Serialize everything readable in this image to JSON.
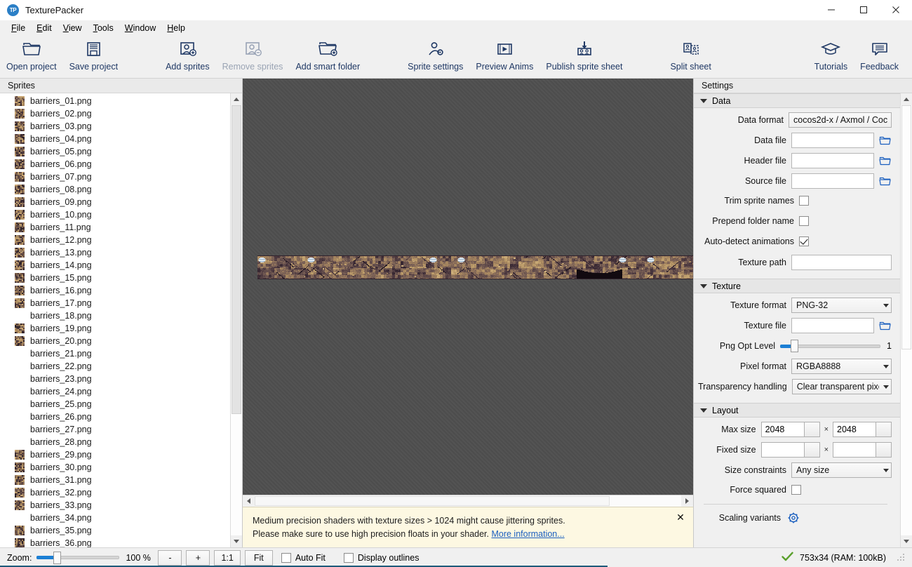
{
  "window": {
    "title": "TexturePacker",
    "logo_text": "TP",
    "minimize_label": "Minimize",
    "maximize_label": "Maximize",
    "close_label": "Close"
  },
  "menubar": {
    "items": [
      {
        "label": "File",
        "accel": "F"
      },
      {
        "label": "Edit",
        "accel": "E"
      },
      {
        "label": "View",
        "accel": "V"
      },
      {
        "label": "Tools",
        "accel": "T"
      },
      {
        "label": "Window",
        "accel": "W"
      },
      {
        "label": "Help",
        "accel": "H"
      }
    ]
  },
  "toolbar": {
    "buttons": [
      {
        "label": "Open project",
        "icon": "open-folder-icon",
        "disabled": false
      },
      {
        "label": "Save project",
        "icon": "floppy-disk-icon",
        "disabled": false
      },
      {
        "label": "Add sprites",
        "icon": "add-sprite-icon",
        "disabled": false
      },
      {
        "label": "Remove sprites",
        "icon": "remove-sprite-icon",
        "disabled": true
      },
      {
        "label": "Add smart folder",
        "icon": "add-folder-icon",
        "disabled": false
      },
      {
        "label": "Sprite settings",
        "icon": "sprite-settings-icon",
        "disabled": false
      },
      {
        "label": "Preview Anims",
        "icon": "film-play-icon",
        "disabled": false
      },
      {
        "label": "Publish sprite sheet",
        "icon": "publish-icon",
        "disabled": false
      },
      {
        "label": "Split sheet",
        "icon": "split-sheet-icon",
        "disabled": false
      }
    ],
    "right_buttons": [
      {
        "label": "Tutorials",
        "icon": "graduation-cap-icon"
      },
      {
        "label": "Feedback",
        "icon": "speech-bubble-icon"
      }
    ]
  },
  "sprites_panel": {
    "title": "Sprites",
    "items": [
      {
        "name": "barriers_01.png",
        "has_thumb": true
      },
      {
        "name": "barriers_02.png",
        "has_thumb": true
      },
      {
        "name": "barriers_03.png",
        "has_thumb": true
      },
      {
        "name": "barriers_04.png",
        "has_thumb": true
      },
      {
        "name": "barriers_05.png",
        "has_thumb": true
      },
      {
        "name": "barriers_06.png",
        "has_thumb": true
      },
      {
        "name": "barriers_07.png",
        "has_thumb": true
      },
      {
        "name": "barriers_08.png",
        "has_thumb": true
      },
      {
        "name": "barriers_09.png",
        "has_thumb": true
      },
      {
        "name": "barriers_10.png",
        "has_thumb": true
      },
      {
        "name": "barriers_11.png",
        "has_thumb": true
      },
      {
        "name": "barriers_12.png",
        "has_thumb": true
      },
      {
        "name": "barriers_13.png",
        "has_thumb": true
      },
      {
        "name": "barriers_14.png",
        "has_thumb": true
      },
      {
        "name": "barriers_15.png",
        "has_thumb": true
      },
      {
        "name": "barriers_16.png",
        "has_thumb": true
      },
      {
        "name": "barriers_17.png",
        "has_thumb": true
      },
      {
        "name": "barriers_18.png",
        "has_thumb": false
      },
      {
        "name": "barriers_19.png",
        "has_thumb": true
      },
      {
        "name": "barriers_20.png",
        "has_thumb": true
      },
      {
        "name": "barriers_21.png",
        "has_thumb": false
      },
      {
        "name": "barriers_22.png",
        "has_thumb": false
      },
      {
        "name": "barriers_23.png",
        "has_thumb": false
      },
      {
        "name": "barriers_24.png",
        "has_thumb": false
      },
      {
        "name": "barriers_25.png",
        "has_thumb": false
      },
      {
        "name": "barriers_26.png",
        "has_thumb": false
      },
      {
        "name": "barriers_27.png",
        "has_thumb": false
      },
      {
        "name": "barriers_28.png",
        "has_thumb": false
      },
      {
        "name": "barriers_29.png",
        "has_thumb": true
      },
      {
        "name": "barriers_30.png",
        "has_thumb": true
      },
      {
        "name": "barriers_31.png",
        "has_thumb": true
      },
      {
        "name": "barriers_32.png",
        "has_thumb": true
      },
      {
        "name": "barriers_33.png",
        "has_thumb": true
      },
      {
        "name": "barriers_34.png",
        "has_thumb": false
      },
      {
        "name": "barriers_35.png",
        "has_thumb": true
      },
      {
        "name": "barriers_36.png",
        "has_thumb": true
      }
    ]
  },
  "canvas": {
    "sheet_alt": "packed sprite sheet preview",
    "warning": {
      "line1": "Medium precision shaders with texture sizes > 1024 might cause jittering sprites.",
      "line2_prefix": "Please make sure to use high precision floats in your shader. ",
      "link_text": "More information...",
      "close_label": "✕"
    }
  },
  "settings": {
    "title": "Settings",
    "sections": [
      {
        "id": "data",
        "title": "Data",
        "expanded": true
      },
      {
        "id": "texture",
        "title": "Texture",
        "expanded": true
      },
      {
        "id": "layout",
        "title": "Layout",
        "expanded": true
      }
    ],
    "data": {
      "data_format_label": "Data format",
      "data_format_value": "cocos2d-x / Axmol / Coc",
      "data_file_label": "Data file",
      "data_file_value": "",
      "header_file_label": "Header file",
      "header_file_value": "",
      "source_file_label": "Source file",
      "source_file_value": "",
      "trim_sprite_names_label": "Trim sprite names",
      "trim_sprite_names_checked": false,
      "prepend_folder_name_label": "Prepend folder name",
      "prepend_folder_name_checked": false,
      "auto_detect_animations_label": "Auto-detect animations",
      "auto_detect_animations_checked": true,
      "texture_path_label": "Texture path",
      "texture_path_value": ""
    },
    "texture": {
      "texture_format_label": "Texture format",
      "texture_format_value": "PNG-32",
      "texture_file_label": "Texture file",
      "texture_file_value": "",
      "png_opt_level_label": "Png Opt Level",
      "png_opt_level_value": "1",
      "png_opt_level_percent": 14,
      "pixel_format_label": "Pixel format",
      "pixel_format_value": "RGBA8888",
      "transparency_handling_label": "Transparency handling",
      "transparency_handling_value": "Clear transparent pixel"
    },
    "layout": {
      "max_size_label": "Max size",
      "max_size_w": "2048",
      "max_size_h": "2048",
      "fixed_size_label": "Fixed size",
      "fixed_size_w": "",
      "fixed_size_h": "",
      "size_constraints_label": "Size constraints",
      "size_constraints_value": "Any size",
      "force_squared_label": "Force squared",
      "force_squared_checked": false,
      "scaling_variants_label": "Scaling variants",
      "times_symbol": "×"
    }
  },
  "statusbar": {
    "zoom_label": "Zoom:",
    "zoom_percent_text": "100 %",
    "zoom_slider_percent": 24,
    "zoom_out_label": "-",
    "zoom_in_label": "+",
    "one_to_one_label": "1:1",
    "fit_label": "Fit",
    "auto_fit_label": "Auto Fit",
    "auto_fit_checked": false,
    "display_outlines_label": "Display outlines",
    "display_outlines_checked": false,
    "status_icon": "green-check-icon",
    "sheet_info": "753x34 (RAM: 100kB)"
  },
  "colors": {
    "accent": "#1f3864",
    "link": "#1b5fbf",
    "warning_bg": "#fdf8e2",
    "canvas_bg": "#4f4f4f",
    "slider_fill": "#1c7fd4",
    "check_green": "#5aa02c"
  }
}
